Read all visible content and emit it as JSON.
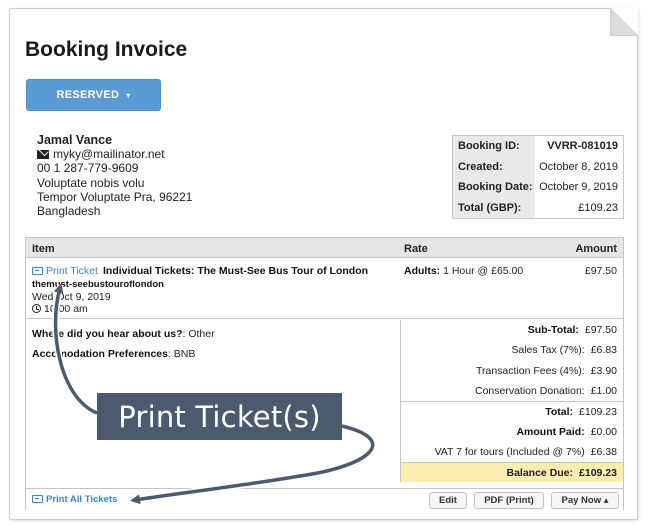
{
  "title": "Booking Invoice",
  "status": {
    "label": "RESERVED",
    "caret": "▾"
  },
  "customer": {
    "name": "Jamal Vance",
    "email": "myky@mailinator.net",
    "phone": "00 1 287-779-9609",
    "address1": "Voluptate nobis volu",
    "address2": "Tempor Voluptate Pra, 96221",
    "country": "Bangladesh"
  },
  "summary": [
    {
      "label": "Booking ID:",
      "value": "VVRR-081019"
    },
    {
      "label": "Created:",
      "value": "October 8, 2019"
    },
    {
      "label": "Booking Date:",
      "value": "October 9, 2019"
    },
    {
      "label": "Total (GBP):",
      "value": "£109.23"
    }
  ],
  "table": {
    "headers": {
      "item": "Item",
      "rate": "Rate",
      "amount": "Amount"
    },
    "item": {
      "print_link": "Print Ticket",
      "name": "Individual Tickets: The Must-See Bus Tour of London",
      "slug": "themust-seebustouroflondon",
      "date": "Wed Oct 9, 2019",
      "time": "10:00 am",
      "rate_label": "Adults:",
      "rate_value": "1 Hour @ £65.00",
      "amount": "£97.50"
    }
  },
  "questions": [
    {
      "q": "Where did you hear about us?",
      "a": ": Other"
    },
    {
      "q": "Accomodation Preferences",
      "a": ": BNB"
    }
  ],
  "totals": [
    {
      "label": "Sub-Total:",
      "value": "£97.50"
    },
    {
      "label": "Sales Tax (7%):",
      "value": "£6.83"
    },
    {
      "label": "Transaction Fees (4%):",
      "value": "£3.90"
    },
    {
      "label": "Conservation Donation:",
      "value": "£1.00"
    },
    {
      "label": "Total:",
      "value": "£109.23"
    },
    {
      "label": "Amount Paid:",
      "value": "£0.00"
    },
    {
      "label": "VAT 7 for tours (Included @ 7%)",
      "value": "£6.38"
    },
    {
      "label": "Balance Due:",
      "value": "£109.23"
    }
  ],
  "footer": {
    "print_all": "Print All Tickets",
    "edit": "Edit",
    "pdf": "PDF (Print)",
    "pay_now": "Pay Now ▴"
  },
  "annotation": "Print Ticket(s)",
  "colors": {
    "accent": "#5b9bd5",
    "link": "#3a86c8",
    "callout": "#4b5a6c",
    "balance_bg": "#fbedb0"
  }
}
